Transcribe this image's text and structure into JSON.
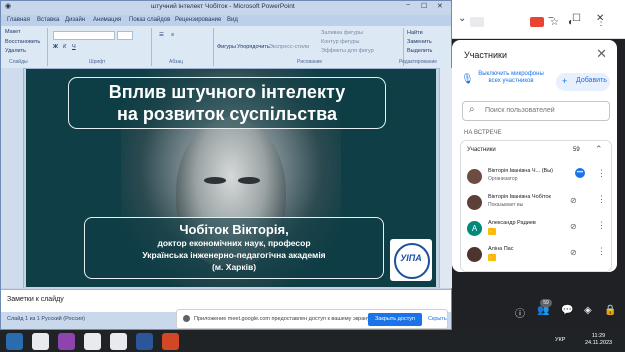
{
  "powerpoint": {
    "window_title": "штучний інтелект Чобіток - Microsoft PowerPoint",
    "tabs": [
      "Главная",
      "Вставка",
      "Дизайн",
      "Анимация",
      "Показ слайдов",
      "Рецензирование",
      "Вид"
    ],
    "ribbon": {
      "paste": "Вставить",
      "cut": "Макет",
      "restore": "Восстановить",
      "delete": "Удалить",
      "shapes": "Фигуры",
      "arrange": "Упорядочить",
      "quick_styles": "Экспресс-стили",
      "shape_fill": "Заливка фигуры",
      "shape_outline": "Контур фигуры",
      "shape_effects": "Эффекты для фигур",
      "find": "Найти",
      "replace": "Заменить",
      "select": "Выделить",
      "group_slides": "Слайды",
      "group_font": "Шрифт",
      "group_paragraph": "Абзац",
      "group_drawing": "Рисование",
      "group_editing": "Редактирование"
    },
    "slide": {
      "title_line1": "Вплив штучного інтелекту",
      "title_line2": "на розвиток суспільства",
      "author_name": "Чобіток Вікторія,",
      "author_degree": "доктор економічних наук, професор",
      "author_org": "Українська інженерно-педагогічна академія",
      "author_city": "(м. Харків)",
      "logo_text": "УІПА"
    },
    "notes_placeholder": "Заметки к слайду",
    "status": "Слайд 1 из 1   Русский (Россия)"
  },
  "share_bar": {
    "message": "Приложение meet.google.com предоставлен доступ к вашему экрану.",
    "stop_label": "Закрыть доступ",
    "hide_label": "Скрыть"
  },
  "meet_panel": {
    "title": "Участники",
    "mute_all_label": "Выключить микрофоны всех участников",
    "add_label": "Добавить",
    "search_placeholder": "Поиск пользователей",
    "in_call_label": "НА ВСТРЕЧЕ",
    "group_label": "Участники",
    "group_count": "59",
    "participants": [
      {
        "name": "Вікторія Іванівна Ч... (Вы)",
        "role": "Организатор"
      },
      {
        "name": "Вікторія Іванівна Чобіток",
        "role": "Показывает вы"
      },
      {
        "name": "Александр Радиев",
        "role": ""
      },
      {
        "name": "Аліна Пас",
        "role": ""
      }
    ]
  },
  "meet_bottom": {
    "participants_badge": "59"
  },
  "taskbar": {
    "time": "11:29",
    "date": "24.11.2023",
    "lang": "УКР"
  }
}
